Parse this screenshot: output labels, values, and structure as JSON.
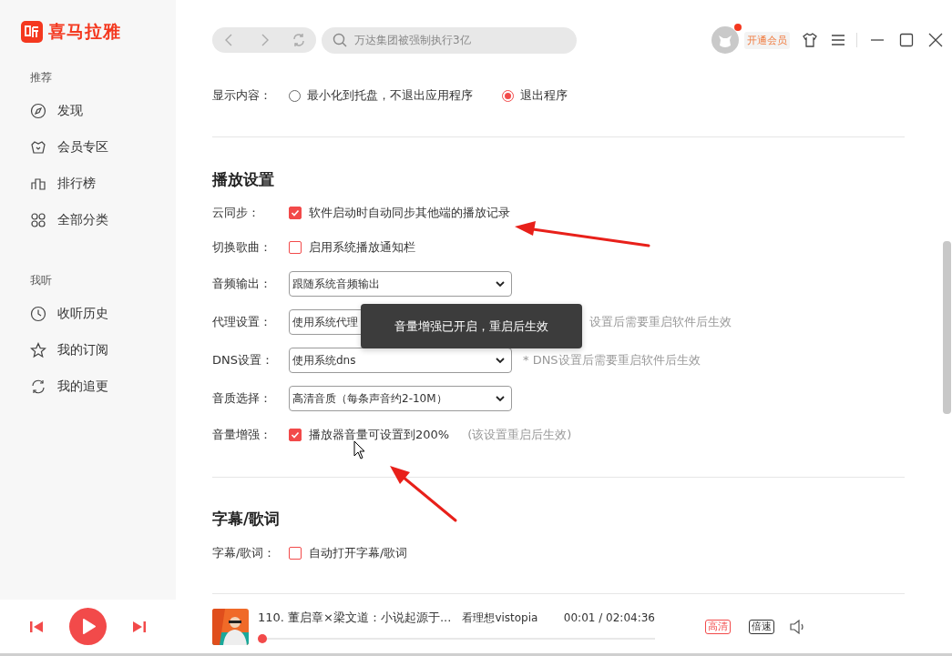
{
  "app": {
    "logo_text": "喜马拉雅"
  },
  "sidebar": {
    "sections": [
      {
        "title": "推荐",
        "items": [
          {
            "label": "发现",
            "selected": false
          },
          {
            "label": "会员专区",
            "selected": false
          },
          {
            "label": "排行榜",
            "selected": false
          },
          {
            "label": "全部分类",
            "selected": false
          }
        ]
      },
      {
        "title": "我听",
        "items": [
          {
            "label": "收听历史",
            "selected": false
          },
          {
            "label": "我的订阅",
            "selected": false
          },
          {
            "label": "我的追更",
            "selected": false
          }
        ]
      }
    ]
  },
  "toolbar": {
    "search_placeholder": "万达集团被强制执行3亿",
    "vip_label": "开通会员",
    "notification": true
  },
  "settings": {
    "display": {
      "label": "显示内容：",
      "options": [
        {
          "label": "最小化到托盘，不退出应用程序",
          "selected": false
        },
        {
          "label": "退出程序",
          "selected": true
        }
      ]
    },
    "sections": [
      {
        "title": "播放设置",
        "rows": [
          {
            "kind": "checkbox",
            "label": "云同步：",
            "text": "软件启动时自动同步其他端的播放记录",
            "checked": true
          },
          {
            "kind": "checkbox",
            "label": "切换歌曲：",
            "text": "启用系统播放通知栏",
            "checked": false
          },
          {
            "kind": "select",
            "label": "音频输出：",
            "value": "跟随系统音频输出"
          },
          {
            "kind": "select",
            "label": "代理设置：",
            "value": "使用系统代理",
            "hint": "设置后需要重启软件后生效"
          },
          {
            "kind": "select",
            "label": "DNS设置：",
            "value": "使用系统dns",
            "hint": "* DNS设置后需要重启软件后生效"
          },
          {
            "kind": "select",
            "label": "音质选择：",
            "value": "高清音质（每条声音约2-10M）"
          },
          {
            "kind": "checkbox",
            "label": "音量增强：",
            "text": "播放器音量可设置到200%",
            "checked": true,
            "hint": "(该设置重启后生效)"
          }
        ]
      },
      {
        "title": "字幕/歌词",
        "rows": [
          {
            "kind": "checkbox",
            "label": "字幕/歌词：",
            "text": "自动打开字幕/歌词",
            "checked": false
          }
        ]
      }
    ]
  },
  "toast": {
    "text": "音量增强已开启，重启后生效"
  },
  "player": {
    "title": "110. 董启章×梁文道：小说起源于...",
    "author": "看理想vistopia",
    "time": "00:01 / 02:04:36",
    "quality": "高清",
    "speed": "倍速",
    "level": 0
  }
}
